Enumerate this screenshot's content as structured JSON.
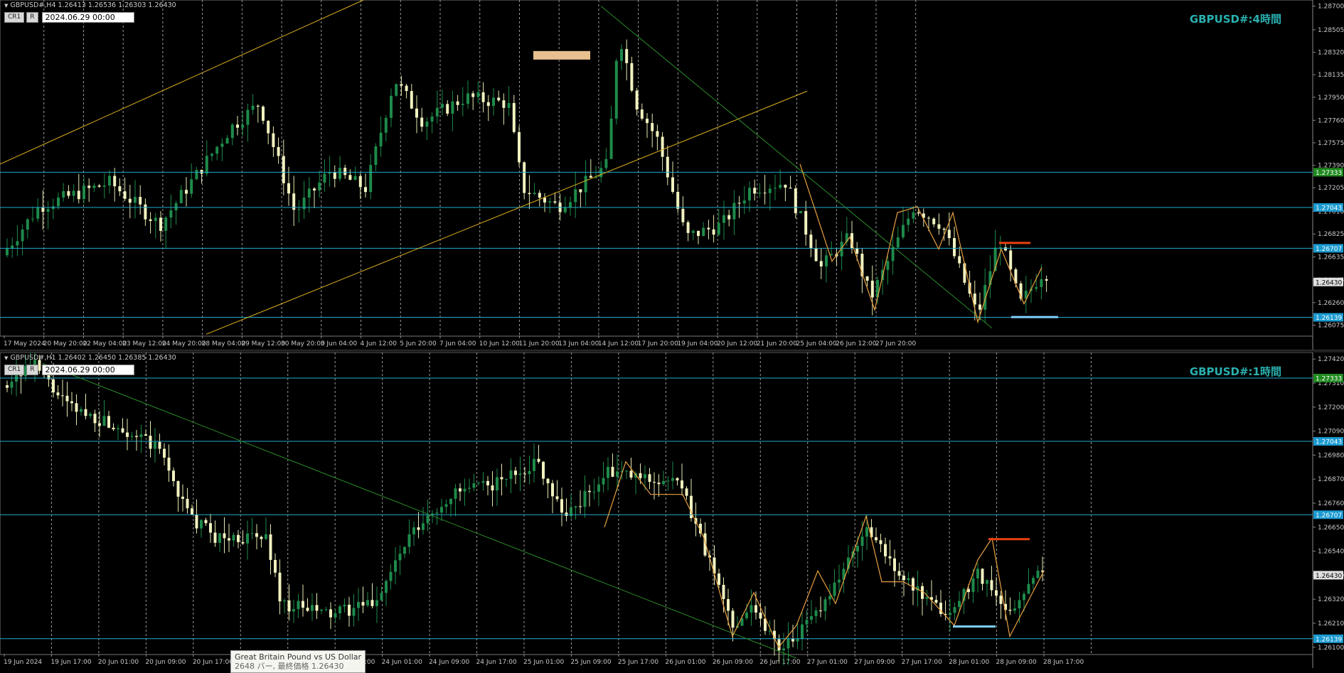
{
  "top_chart": {
    "header": "GBPUSD#,H4  1.26413 1.26536 1.26303 1.26430",
    "watermark": "GBPUSD#:4時間",
    "date_field": "2024.06.29 00:00",
    "buttons": [
      "CR1",
      "R"
    ],
    "price_labels": [
      "1.28700",
      "1.28505",
      "1.28320",
      "1.28135",
      "1.27950",
      "1.27760",
      "1.27575",
      "1.27390",
      "1.27205",
      "1.27010",
      "1.26825",
      "1.26635",
      "1.26445",
      "1.26260",
      "1.26075"
    ],
    "price_min": 1.2599,
    "price_max": 1.2875,
    "level_lines": [
      {
        "value": 1.27333,
        "label": "1.27333",
        "box": "#1f8a1f",
        "color": "#22aacc"
      },
      {
        "value": 1.27043,
        "label": "1.27043",
        "box": "#1a9ad0",
        "color": "#22aacc"
      },
      {
        "value": 1.26707,
        "label": "1.26707",
        "box": "#1a9ad0",
        "color": "#22aacc"
      },
      {
        "value": 1.26139,
        "label": "1.26139",
        "box": "#1a9ad0",
        "color": "#22aacc"
      }
    ],
    "current_price": {
      "value": 1.2643,
      "label": "1.26430"
    },
    "time_labels": [
      "17 May 2024",
      "20 May 20:00",
      "22 May 04:00",
      "23 May 12:00",
      "24 May 20:00",
      "28 May 04:00",
      "29 May 12:00",
      "30 May 20:00",
      "3 Jun 04:00",
      "4 Jun 12:00",
      "5 Jun 20:00",
      "7 Jun 04:00",
      "10 Jun 12:00",
      "11 Jun 20:00",
      "13 Jun 04:00",
      "14 Jun 12:00",
      "17 Jun 20:00",
      "19 Jun 04:00",
      "20 Jun 12:00",
      "21 Jun 20:00",
      "25 Jun 04:00",
      "26 Jun 12:00",
      "27 Jun 20:00"
    ]
  },
  "bottom_chart": {
    "header": "GBPUSD#,H1  1.26402 1.26450 1.26385 1.26430",
    "watermark": "GBPUSD#:1時間",
    "date_field": "2024.06.29 00:00",
    "buttons": [
      "CR1",
      "R"
    ],
    "price_labels": [
      "1.27420",
      "1.27310",
      "1.27200",
      "1.27090",
      "1.26980",
      "1.26870",
      "1.26760",
      "1.26650",
      "1.26540",
      "1.26430",
      "1.26320",
      "1.26210",
      "1.26100"
    ],
    "price_min": 1.2607,
    "price_max": 1.2745,
    "level_lines": [
      {
        "value": 1.27333,
        "label": "1.27333",
        "box": "#1f8a1f",
        "color": "#22aacc"
      },
      {
        "value": 1.27043,
        "label": "1.27043",
        "box": "#1a9ad0",
        "color": "#22aacc"
      },
      {
        "value": 1.26707,
        "label": "1.26707",
        "box": "#1a9ad0",
        "color": "#22aacc"
      },
      {
        "value": 1.26139,
        "label": "1.26139",
        "box": "#1a9ad0",
        "color": "#22aacc"
      }
    ],
    "current_price": {
      "value": 1.2643,
      "label": "1.26430"
    },
    "time_labels": [
      "19 Jun 2024",
      "19 Jun 17:00",
      "20 Jun 01:00",
      "20 Jun 09:00",
      "20 Jun 17:00",
      "21 Jun 01:00",
      "21 Jun 09:00",
      "21 Jun 17:00",
      "24 Jun 01:00",
      "24 Jun 09:00",
      "24 Jun 17:00",
      "25 Jun 01:00",
      "25 Jun 09:00",
      "25 Jun 17:00",
      "26 Jun 01:00",
      "26 Jun 09:00",
      "26 Jun 17:00",
      "27 Jun 01:00",
      "27 Jun 09:00",
      "27 Jun 17:00",
      "28 Jun 01:00",
      "28 Jun 09:00",
      "28 Jun 17:00"
    ]
  },
  "tooltip": {
    "line1": "Great Britain Pound vs US Dollar",
    "line2": "2648 バー, 最終価格 1.26430"
  },
  "colors": {
    "bull": "#1e8a4a",
    "bear": "#f2f2c0",
    "level_line": "#22aacc",
    "trend_line": "#e0b020",
    "diag_line": "#2a8a2a",
    "zigzag": "#e8a040",
    "red_mark": "#e84010",
    "blue_mark": "#80d0ff",
    "peach_rect": "#e8c090"
  }
}
